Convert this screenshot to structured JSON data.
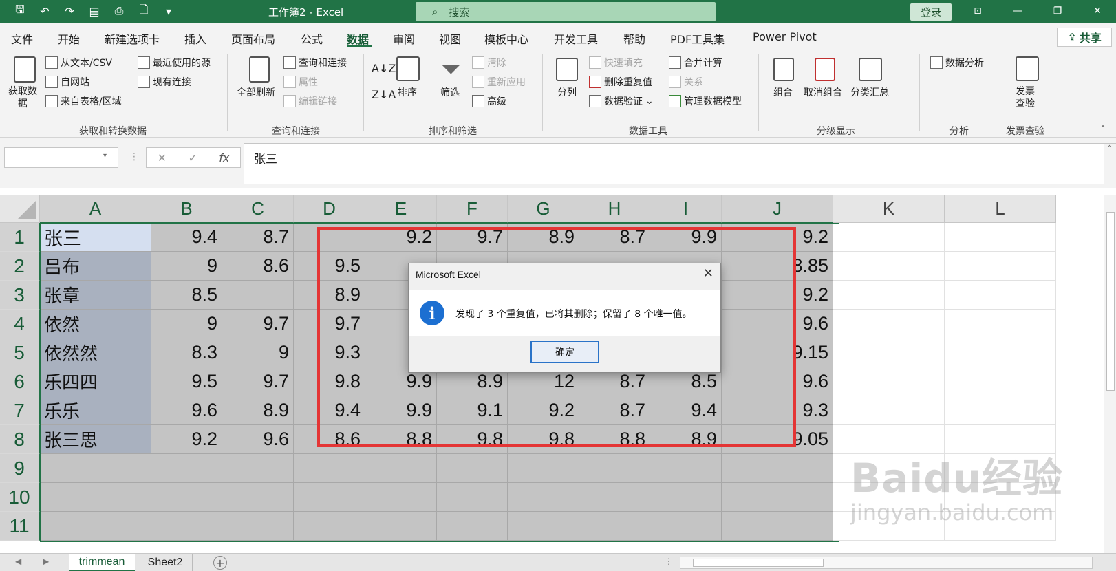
{
  "app": {
    "doc_title": "工作簿2 - Excel",
    "search_placeholder": "搜索",
    "login_label": "登录",
    "share_label": "共享",
    "accent_color": "#217346"
  },
  "menu": {
    "tabs": [
      "文件",
      "开始",
      "新建选项卡",
      "插入",
      "页面布局",
      "公式",
      "数据",
      "审阅",
      "视图",
      "模板中心",
      "开发工具",
      "帮助",
      "PDF工具集",
      "Power Pivot"
    ],
    "active": "数据"
  },
  "ribbon": {
    "get_data": "获取数\n据",
    "from_text_csv": "从文本/CSV",
    "from_web": "自网站",
    "from_table": "来自表格/区域",
    "recent_sources": "最近使用的源",
    "existing_connections": "现有连接",
    "group_get_transform": "获取和转换数据",
    "refresh_all": "全部刷新",
    "queries_connections": "查询和连接",
    "properties": "属性",
    "edit_links": "编辑链接",
    "group_queries": "查询和连接",
    "sort": "排序",
    "filter": "筛选",
    "clear": "清除",
    "reapply": "重新应用",
    "advanced": "高级",
    "group_sort_filter": "排序和筛选",
    "text_to_columns": "分列",
    "flash_fill": "快速填充",
    "remove_duplicates": "删除重复值",
    "data_validation": "数据验证",
    "consolidate": "合并计算",
    "relationships": "关系",
    "manage_data_model": "管理数据模型",
    "group_data_tools": "数据工具",
    "group": "组合",
    "ungroup": "取消组合",
    "subtotal": "分类汇总",
    "group_outline": "分级显示",
    "data_analysis": "数据分析",
    "group_analysis": "分析",
    "invoice_check": "发票\n查验",
    "group_invoice": "发票查验"
  },
  "formula_bar": {
    "name_box": "",
    "cancel": "✕",
    "enter": "✓",
    "fx": "fx",
    "content": "张三"
  },
  "sheet": {
    "columns": [
      "A",
      "B",
      "C",
      "D",
      "E",
      "F",
      "G",
      "H",
      "I",
      "J",
      "K",
      "L"
    ],
    "rows": [
      "1",
      "2",
      "3",
      "4",
      "5",
      "6",
      "7",
      "8",
      "9",
      "10",
      "11"
    ],
    "cells": [
      [
        "张三",
        "9.4",
        "8.7",
        "",
        "9.2",
        "9.7",
        "8.9",
        "8.7",
        "9.9",
        "9.2"
      ],
      [
        "吕布",
        "9",
        "8.6",
        "9.5",
        "",
        "",
        "",
        "",
        "",
        "8.85"
      ],
      [
        "张章",
        "8.5",
        "",
        "8.9",
        "",
        "",
        "",
        "",
        "",
        "9.2"
      ],
      [
        "依然",
        "9",
        "9.7",
        "9.7",
        "",
        "",
        "",
        "",
        "",
        "9.6"
      ],
      [
        "依然然",
        "8.3",
        "9",
        "9.3",
        "",
        "",
        "",
        "",
        "",
        "9.15"
      ],
      [
        "乐四四",
        "9.5",
        "9.7",
        "9.8",
        "9.9",
        "8.9",
        "12",
        "8.7",
        "8.5",
        "9.6"
      ],
      [
        "乐乐",
        "9.6",
        "8.9",
        "9.4",
        "9.9",
        "9.1",
        "9.2",
        "8.7",
        "9.4",
        "9.3"
      ],
      [
        "张三思",
        "9.2",
        "9.6",
        "8.6",
        "8.8",
        "9.8",
        "9.8",
        "8.8",
        "8.9",
        "9.05"
      ],
      [
        "",
        "",
        "",
        "",
        "",
        "",
        "",
        "",
        "",
        ""
      ],
      [
        "",
        "",
        "",
        "",
        "",
        "",
        "",
        "",
        "",
        ""
      ],
      [
        "",
        "",
        "",
        "",
        "",
        "",
        "",
        "",
        "",
        ""
      ]
    ]
  },
  "dialog": {
    "title": "Microsoft Excel",
    "message": "发现了 3 个重复值，已将其删除；保留了 8 个唯一值。",
    "ok": "确定",
    "icon": "info-icon"
  },
  "sheets": {
    "tabs": [
      "trimmean",
      "Sheet2"
    ],
    "active": "trimmean",
    "add": "+"
  },
  "watermark": {
    "main": "Baidu经验",
    "sub": "jingyan.baidu.com"
  }
}
